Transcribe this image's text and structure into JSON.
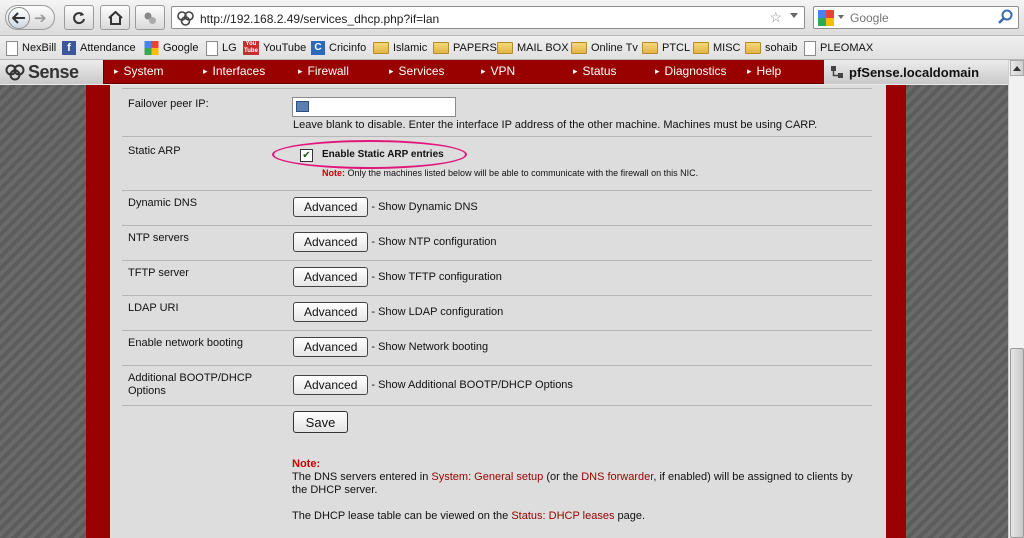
{
  "browser": {
    "url": "http://192.168.2.49/services_dhcp.php?if=lan",
    "search_placeholder": "Google"
  },
  "bookmarks": [
    {
      "label": "NexBill",
      "icon": "page-icon"
    },
    {
      "label": "Attendance",
      "icon": "facebook-icon"
    },
    {
      "label": "Google",
      "icon": "google-icon"
    },
    {
      "label": "LG",
      "icon": "page-icon"
    },
    {
      "label": "YouTube",
      "icon": "youtube-icon"
    },
    {
      "label": "Cricinfo",
      "icon": "cricinfo-icon"
    },
    {
      "label": "Islamic",
      "icon": "folder-icon"
    },
    {
      "label": "PAPERS",
      "icon": "folder-icon"
    },
    {
      "label": "MAIL BOX",
      "icon": "folder-icon"
    },
    {
      "label": "Online Tv",
      "icon": "folder-icon"
    },
    {
      "label": "PTCL",
      "icon": "folder-icon"
    },
    {
      "label": "MISC",
      "icon": "folder-icon"
    },
    {
      "label": "sohaib",
      "icon": "folder-icon"
    },
    {
      "label": "PLEOMAX",
      "icon": "page-icon"
    }
  ],
  "pfsense": {
    "logo": "Sense",
    "menu": [
      "System",
      "Interfaces",
      "Firewall",
      "Services",
      "VPN",
      "Status",
      "Diagnostics",
      "Help"
    ],
    "hostname": "pfSense.localdomain"
  },
  "form": {
    "failover": {
      "label": "Failover peer IP:",
      "help": "Leave blank to disable. Enter the interface IP address of the other machine. Machines must be using CARP."
    },
    "static_arp": {
      "label": "Static ARP",
      "checkbox_label": "Enable Static ARP entries",
      "note_prefix": "Note:",
      "note_text": " Only the machines listed below will be able to communicate with the firewall on this NIC."
    },
    "advanced_rows": [
      {
        "label": "Dynamic DNS",
        "button": "Advanced",
        "desc": "- Show Dynamic DNS"
      },
      {
        "label": "NTP servers",
        "button": "Advanced",
        "desc": "- Show NTP configuration"
      },
      {
        "label": "TFTP server",
        "button": "Advanced",
        "desc": "- Show TFTP configuration"
      },
      {
        "label": "LDAP URI",
        "button": "Advanced",
        "desc": "- Show LDAP configuration"
      },
      {
        "label": "Enable network booting",
        "button": "Advanced",
        "desc": "- Show Network booting"
      },
      {
        "label": "Additional BOOTP/DHCP Options",
        "button": "Advanced",
        "desc": "- Show Additional BOOTP/DHCP Options"
      }
    ],
    "save_label": "Save",
    "bottom_note": {
      "heading": "Note:",
      "p1_a": "The DNS servers entered in ",
      "p1_link1": "System: General setup",
      "p1_b": " (or the ",
      "p1_link2": "DNS forwarder",
      "p1_c": ", if enabled) will be assigned to clients by the DHCP server.",
      "p2_a": "The DHCP lease table can be viewed on the ",
      "p2_link": "Status: DHCP leases",
      "p2_b": " page."
    }
  }
}
